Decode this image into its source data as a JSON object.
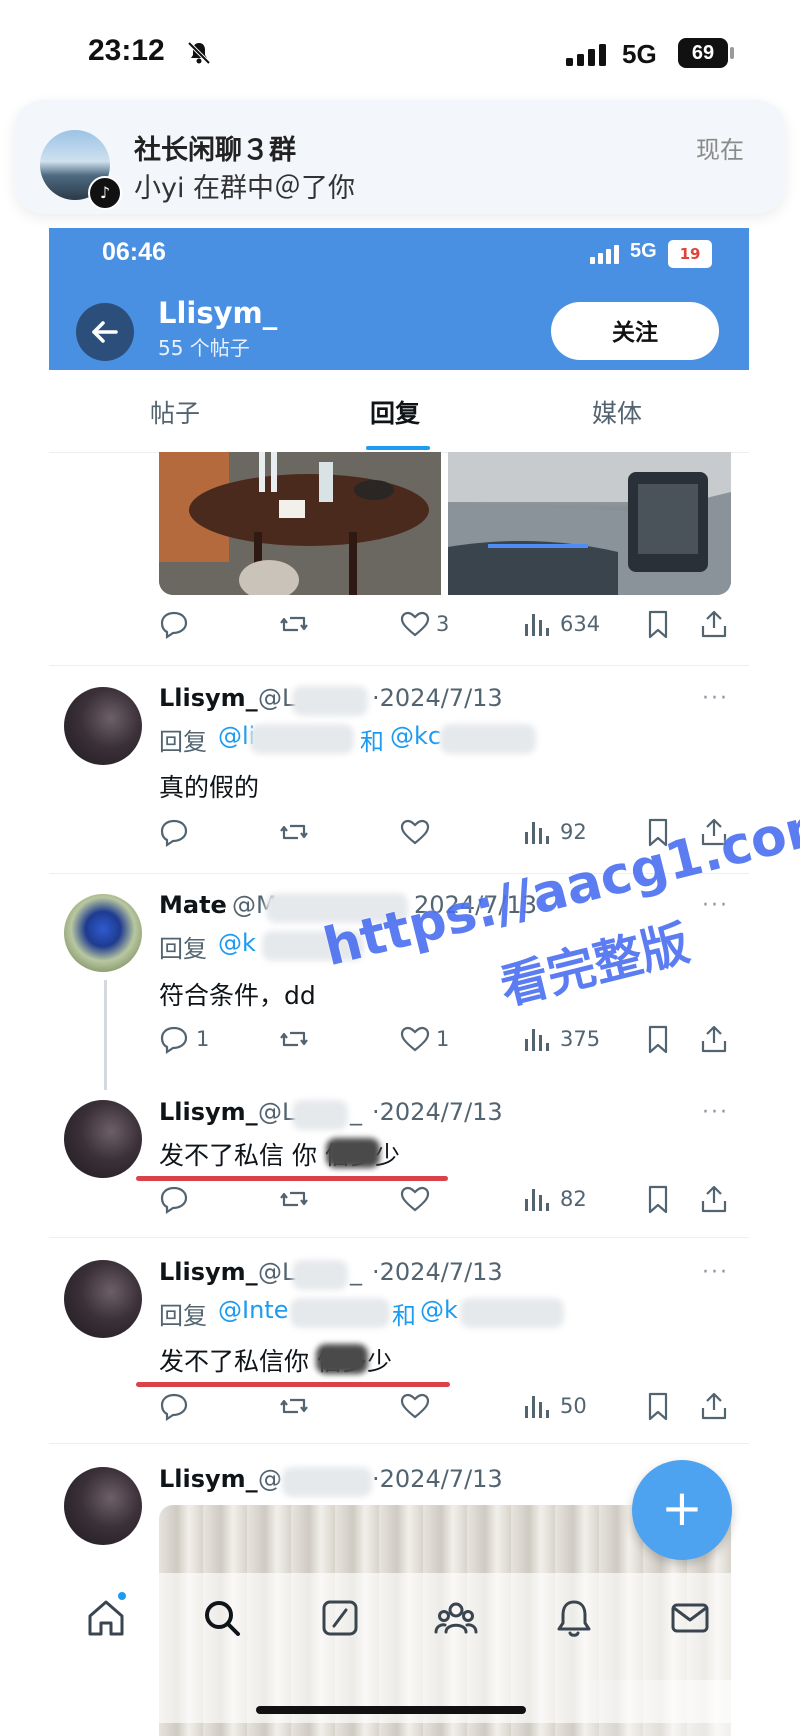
{
  "outer_status": {
    "time": "23:12",
    "network": "5G",
    "battery": "69"
  },
  "notification": {
    "title": "社长闲聊３群",
    "body": "小yi 在群中＠了你",
    "time": "现在"
  },
  "inner_status": {
    "time": "06:46",
    "network": "5G",
    "battery": "19"
  },
  "profile": {
    "name": "Llisym_",
    "posts_count": "55 个帖子",
    "follow_label": "关注"
  },
  "tabs": [
    {
      "label": "帖子"
    },
    {
      "label": "回复",
      "selected": true
    },
    {
      "label": "媒体"
    }
  ],
  "first_post_actions": {
    "likes": "3",
    "views": "634"
  },
  "tweets": [
    {
      "name": "Llisym_",
      "handle": "@L",
      "date": "·2024/7/13",
      "reply_prefix": "回复",
      "mention_a": "@li",
      "and_word": "和",
      "mention_b": "@kc",
      "text": "真的假的",
      "replies": "",
      "likes": "",
      "views": "92"
    },
    {
      "name": "Mate",
      "handle": "@M",
      "date": "2024/7/13",
      "reply_prefix": "回复",
      "mention_a": "@k",
      "text": "符合条件，dd",
      "replies": "1",
      "likes": "1",
      "views": "375"
    },
    {
      "name": "Llisym_",
      "handle": "@L",
      "handle_tail": "_",
      "date": "·2024/7/13",
      "text": "发不了私信 你    信多少",
      "views": "82"
    },
    {
      "name": "Llisym_",
      "handle": "@L",
      "handle_tail": "_",
      "date": "·2024/7/13",
      "reply_prefix": "回复",
      "mention_a": "@Inte",
      "and_word": "和",
      "mention_b": "@k",
      "text": "发不了私信你    信多少",
      "views": "50"
    },
    {
      "name": "Llisym_",
      "handle": "@",
      "date": "·2024/7/13"
    }
  ],
  "more_label": "···",
  "watermark": {
    "url": "https://aacg1.com",
    "sub": "看完整版"
  },
  "fab_label": "+",
  "colors": {
    "accent": "#1d9bf0",
    "header_blue": "#4a90e2",
    "underline_red": "#d9414b",
    "watermark": "#4a6ff0"
  },
  "icons": [
    "bell-off-icon",
    "back-arrow-icon",
    "reply-icon",
    "retweet-icon",
    "heart-icon",
    "views-icon",
    "bookmark-icon",
    "share-icon",
    "home-icon",
    "search-icon",
    "compose-icon",
    "communities-icon",
    "notifications-icon",
    "messages-icon"
  ]
}
